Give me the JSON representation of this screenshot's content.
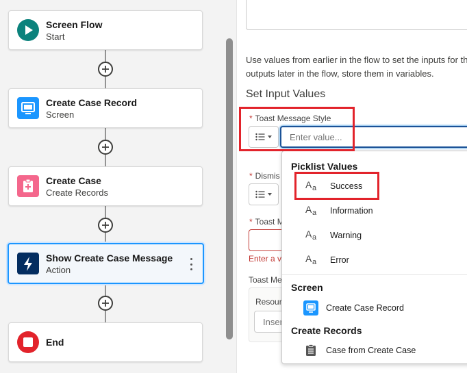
{
  "canvas": {
    "nodes": [
      {
        "title": "Screen Flow",
        "subtitle": "Start",
        "icon": "play-icon",
        "color": "#0b827c"
      },
      {
        "title": "Create Case Record",
        "subtitle": "Screen",
        "icon": "screen-icon",
        "color": "#1b96ff"
      },
      {
        "title": "Create Case",
        "subtitle": "Create Records",
        "icon": "create-records-icon",
        "color": "#f4678c"
      },
      {
        "title": "Show Create Case Message",
        "subtitle": "Action",
        "icon": "lightning-icon",
        "color": "#032d60"
      },
      {
        "title": "End",
        "subtitle": "",
        "icon": "stop-icon",
        "color": "#e2232b"
      }
    ]
  },
  "panel": {
    "help_text_line1": "Use values from earlier in the flow to set the inputs for th",
    "help_text_line2": "outputs later in the flow, store them in variables.",
    "section_title": "Set Input Values",
    "fields": {
      "toast_style_label": "Toast Message Style",
      "toast_style_placeholder": "Enter value...",
      "dismiss_label": "Dismis",
      "toast_message_label": "Toast M",
      "error_text": "Enter a va",
      "toast_me_label": "Toast Me",
      "resource_label": "Resourc",
      "resource_placeholder": "Inser"
    }
  },
  "dropdown": {
    "picklist_header": "Picklist Values",
    "picklist_items": [
      "Success",
      "Information",
      "Warning",
      "Error"
    ],
    "screen_header": "Screen",
    "screen_items": [
      "Create Case Record"
    ],
    "records_header": "Create Records",
    "records_items": [
      "Case from Create Case"
    ]
  },
  "colors": {
    "highlight": "#e2232b",
    "focus": "#1b5297",
    "selected_node_border": "#1b96ff"
  }
}
